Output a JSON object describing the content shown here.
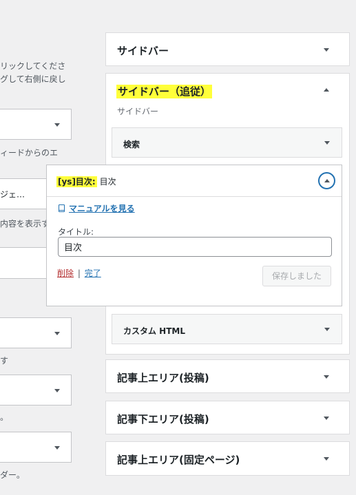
{
  "left": {
    "instr_line1": "リックしてくださ",
    "instr_line2": "グして右側に戻し",
    "text_field": "ィードからのエ",
    "dropdown_value": "ジェ…",
    "text_show": "内容を表示す",
    "text_su": "す",
    "text_period": "。",
    "text_ender": "ダー。"
  },
  "areas": {
    "sidebar": {
      "title": "サイドバー"
    },
    "sidebar_follow": {
      "title": "サイドバー（追従）",
      "description": "サイドバー"
    },
    "article_top_post": {
      "title": "記事上エリア(投稿)"
    },
    "article_bottom_post": {
      "title": "記事下エリア(投稿)"
    },
    "article_top_page": {
      "title": "記事上エリア(固定ページ)"
    }
  },
  "widgets": {
    "search": {
      "title": "検索"
    },
    "custom_html": {
      "title": "カスタム HTML"
    }
  },
  "toc_widget": {
    "prefix": "[ys]目次:",
    "name": "目次",
    "manual_link": "マニュアルを見る",
    "title_label": "タイトル:",
    "title_value": "目次",
    "delete_label": "削除",
    "separator": "|",
    "done_label": "完了",
    "saved_label": "保存しました"
  },
  "colors": {
    "highlight": "#ffff3a",
    "accent": "#2271b1",
    "delete": "#b32d2e",
    "background": "#f0f0f1"
  },
  "icons": {
    "toggle_closed": "caret-down-icon",
    "toggle_open": "caret-up-icon",
    "manual": "book-icon"
  }
}
